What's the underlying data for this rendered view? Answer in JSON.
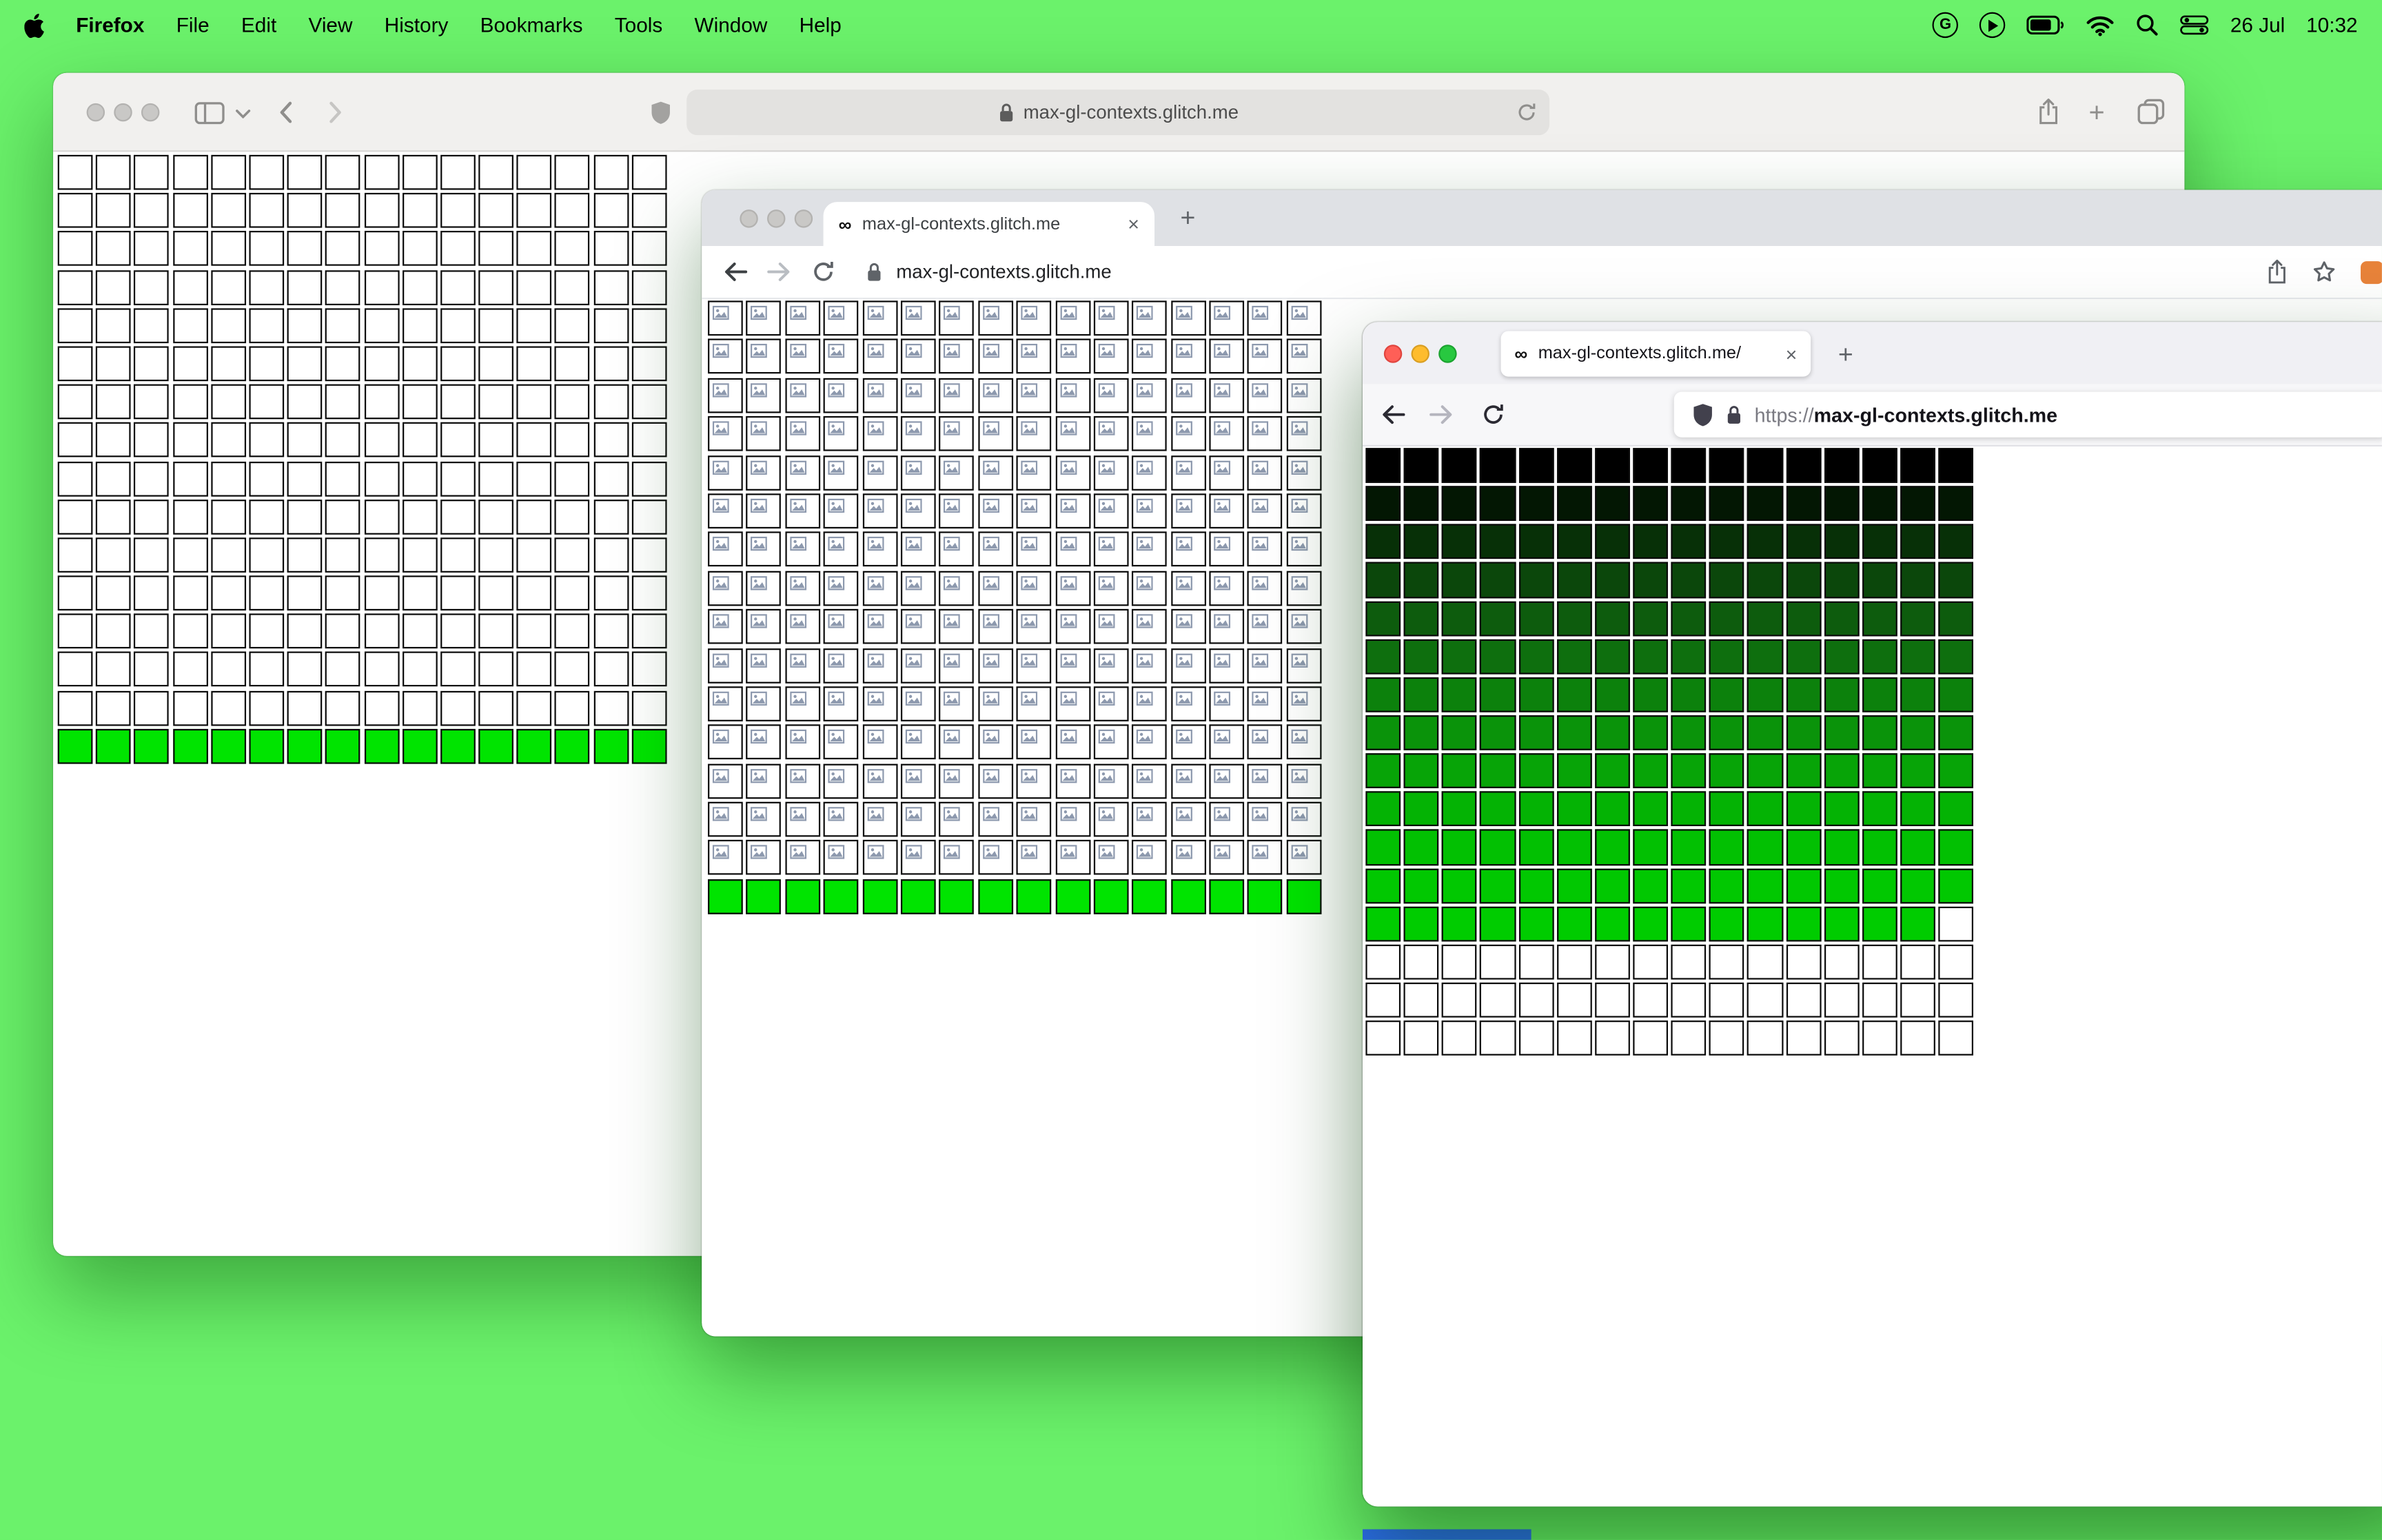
{
  "menu_bar": {
    "app_name": "Firefox",
    "items": [
      "File",
      "Edit",
      "View",
      "History",
      "Bookmarks",
      "Tools",
      "Window",
      "Help"
    ],
    "google_glyph": "G",
    "date": "26 Jul",
    "time": "10:32"
  },
  "window_back": {
    "url": "max-gl-contexts.glitch.me",
    "grid": {
      "cols": 16,
      "rows": 16,
      "default_color": "#ffffff",
      "green_rows": [
        15
      ],
      "green_color": "#00e400",
      "cell_border": "#0a0a0a",
      "broken_icons": false
    }
  },
  "window_middle": {
    "tab_favicon": "∞",
    "tab_title": "max-gl-contexts.glitch.me",
    "close_label": "×",
    "new_tab_label": "+",
    "url": "max-gl-contexts.glitch.me",
    "grid": {
      "cols": 16,
      "rows": 16,
      "default_color": "#ffffff",
      "green_rows": [
        15
      ],
      "green_color": "#00e400",
      "cell_border": "#0a0a0a",
      "broken_icons": true
    }
  },
  "window_front": {
    "tab_favicon": "∞",
    "tab_title": "max-gl-contexts.glitch.me/",
    "close_label": "×",
    "new_tab_label": "+",
    "url_scheme": "https://",
    "url_host": "max-gl-contexts.glitch.me",
    "grid": {
      "cols": 16,
      "rows": 16,
      "row_colors": [
        "#000000",
        "#031703",
        "#073007",
        "#0b470b",
        "#0d5c0d",
        "#0e6f0e",
        "#0c810c",
        "#0a930a",
        "#07a407",
        "#04b304",
        "#02c002",
        "#01c801",
        "#00cc00",
        "#ffffff",
        "#ffffff",
        "#ffffff"
      ],
      "exceptions": [
        {
          "row": 12,
          "col": 15,
          "color": "#ffffff"
        }
      ],
      "cell_border": "#0a0a0a",
      "broken_icons": false
    }
  },
  "colors": {
    "desktop_green": "#6bf26b",
    "success_green": "#00e400",
    "blue_strip": "#2e6cf6"
  }
}
